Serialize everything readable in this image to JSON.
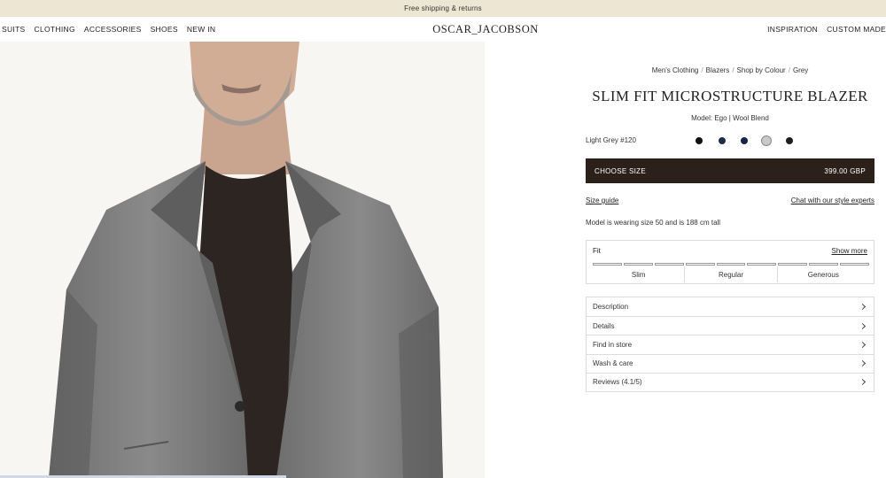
{
  "promo": {
    "text": "Free shipping & returns"
  },
  "nav": {
    "left": [
      "SUITS",
      "CLOTHING",
      "ACCESSORIES",
      "SHOES",
      "NEW IN"
    ],
    "logo": "OSCAR_JACOBSON",
    "right": [
      "INSPIRATION",
      "CUSTOM MADE"
    ]
  },
  "breadcrumb": [
    "Men's Clothing",
    "Blazers",
    "Shop by Colour",
    "Grey"
  ],
  "product": {
    "title": "SLIM FIT MICROSTRUCTURE BLAZER",
    "model": "Model: Ego | Wool Blend",
    "color_label": "Light Grey #120",
    "swatches": [
      {
        "name": "black",
        "color": "#111111",
        "selected": false
      },
      {
        "name": "navy",
        "color": "#1c2c4a",
        "selected": false
      },
      {
        "name": "dark-navy",
        "color": "#162447",
        "selected": false
      },
      {
        "name": "light-grey",
        "color": "#c9c9c9",
        "selected": true
      },
      {
        "name": "charcoal",
        "color": "#1f1f1f",
        "selected": false
      }
    ],
    "choose_size": "CHOOSE SIZE",
    "price": "399.00 GBP",
    "size_guide": "Size guide",
    "chat": "Chat with our style experts",
    "model_note": "Model is wearing size 50 and is 188 cm tall"
  },
  "fit": {
    "label": "Fit",
    "more": "Show more",
    "options": [
      "Slim",
      "Regular",
      "Generous"
    ]
  },
  "accordion": [
    "Description",
    "Details",
    "Find in store",
    "Wash & care",
    "Reviews (4.1/5)"
  ]
}
